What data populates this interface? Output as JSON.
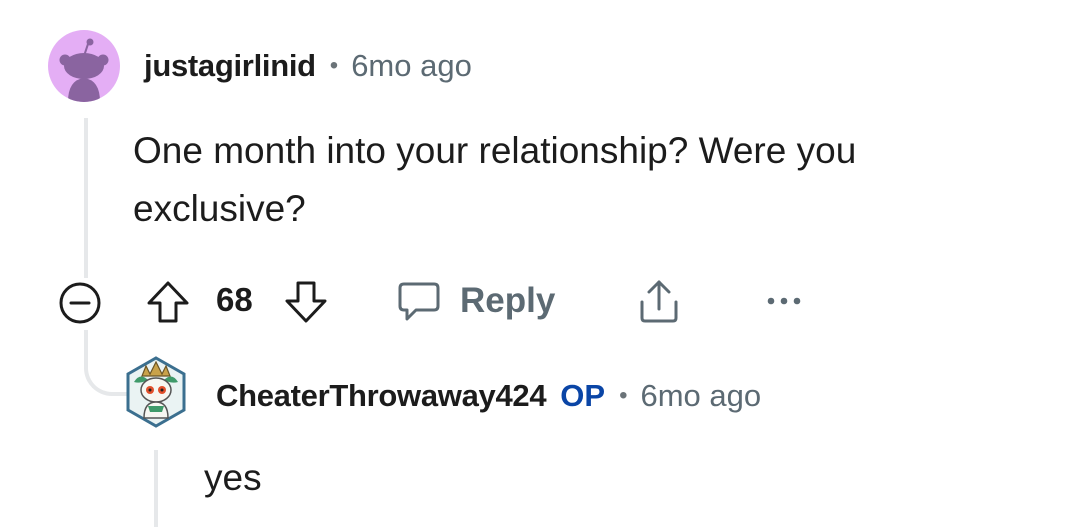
{
  "comments": [
    {
      "author": "justagirlinid",
      "separator": "•",
      "time": "6mo ago",
      "body": "One month into your relationship? Were you exclusive?",
      "score": "68",
      "reply_label": "Reply",
      "avatar_color": "#e4aef5",
      "icons": [
        "collapse-minus-icon",
        "upvote-arrow-icon",
        "downvote-arrow-icon",
        "speech-bubble-icon",
        "share-icon",
        "more-dots-icon"
      ]
    },
    {
      "author": "CheaterThrowaway424",
      "op_badge": "OP",
      "separator": "•",
      "time": "6mo ago",
      "body": "yes"
    }
  ],
  "colors": {
    "text": "#1c1c1c",
    "muted": "#5c6a73",
    "op_blue": "#0a45a6",
    "thread_line": "#e6e8ea"
  }
}
